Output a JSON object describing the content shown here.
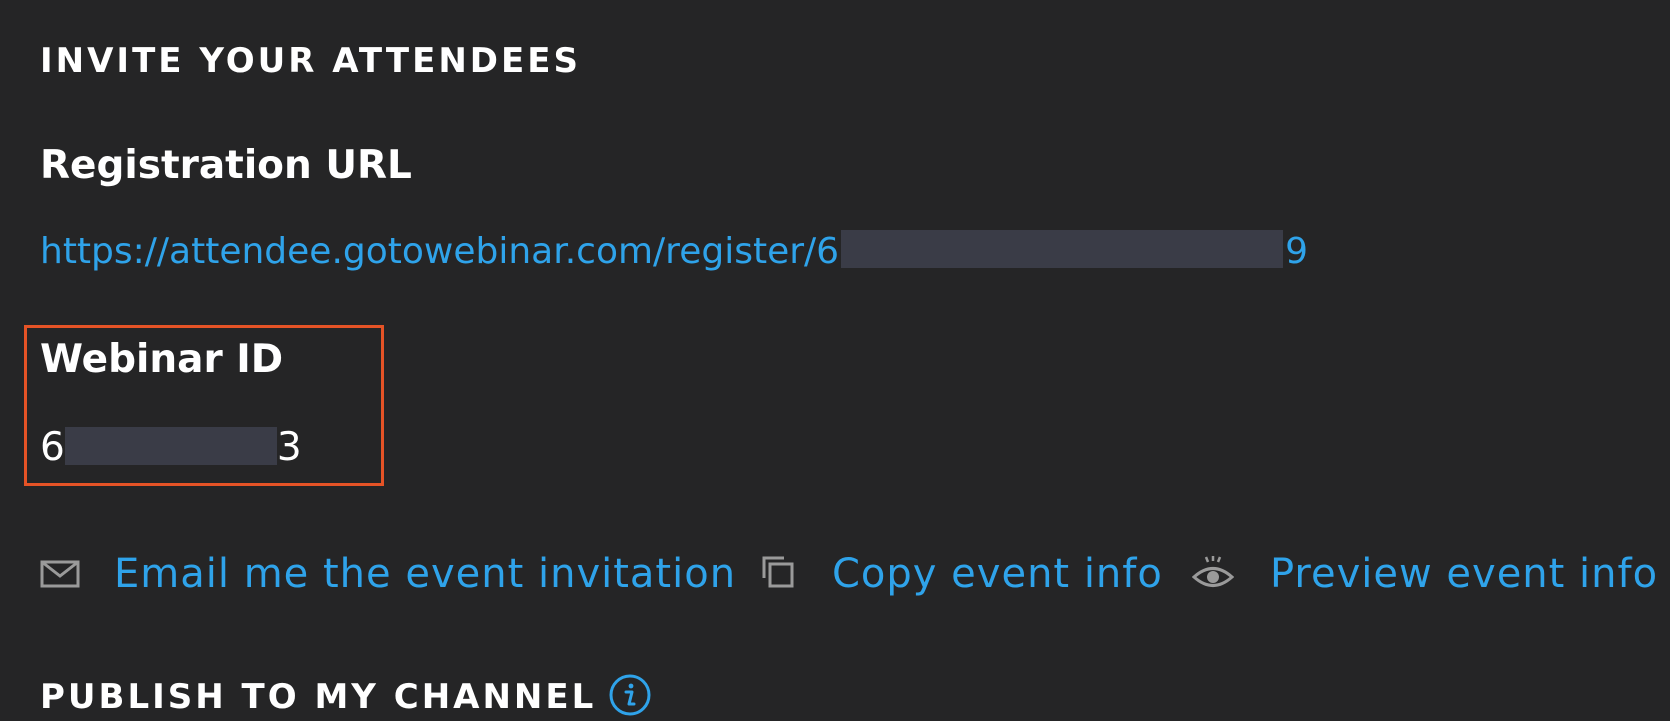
{
  "invite": {
    "heading": "INVITE YOUR ATTENDEES"
  },
  "registration": {
    "label": "Registration URL",
    "url_prefix": "https://attendee.gotowebinar.com/register/6",
    "url_suffix": "9"
  },
  "webinar": {
    "label": "Webinar ID",
    "id_prefix": "6",
    "id_suffix": "3"
  },
  "actions": {
    "email_label": "Email me the event invitation",
    "copy_label": "Copy event info",
    "preview_label": "Preview event info"
  },
  "publish": {
    "heading": "PUBLISH TO MY CHANNEL"
  },
  "icons": {
    "email": "envelope-icon",
    "copy": "copy-icon",
    "preview": "eye-icon",
    "info": "info-icon"
  },
  "colors": {
    "background": "#252526",
    "link": "#2fa3ea",
    "highlight": "#e55326",
    "redaction": "#3a3c47",
    "icon_gray": "#9a9a9a"
  }
}
